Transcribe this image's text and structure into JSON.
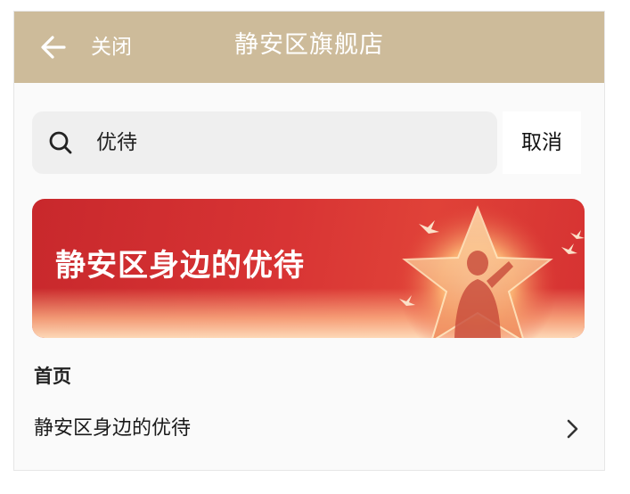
{
  "header": {
    "back_icon": "back-arrow-icon",
    "close_label": "关闭",
    "title": "静安区旗舰店",
    "background": "#cdbb9a"
  },
  "search": {
    "icon": "search-icon",
    "query": "优待",
    "cancel_label": "取消"
  },
  "banner": {
    "text": "静安区身边的优待",
    "background": "#d83434",
    "icons": [
      "star-icon",
      "salute-silhouette-icon",
      "dove-icon"
    ]
  },
  "results": {
    "section_title": "首页",
    "items": [
      {
        "label": "静安区身边的优待",
        "icon": "chevron-right-icon"
      }
    ]
  }
}
